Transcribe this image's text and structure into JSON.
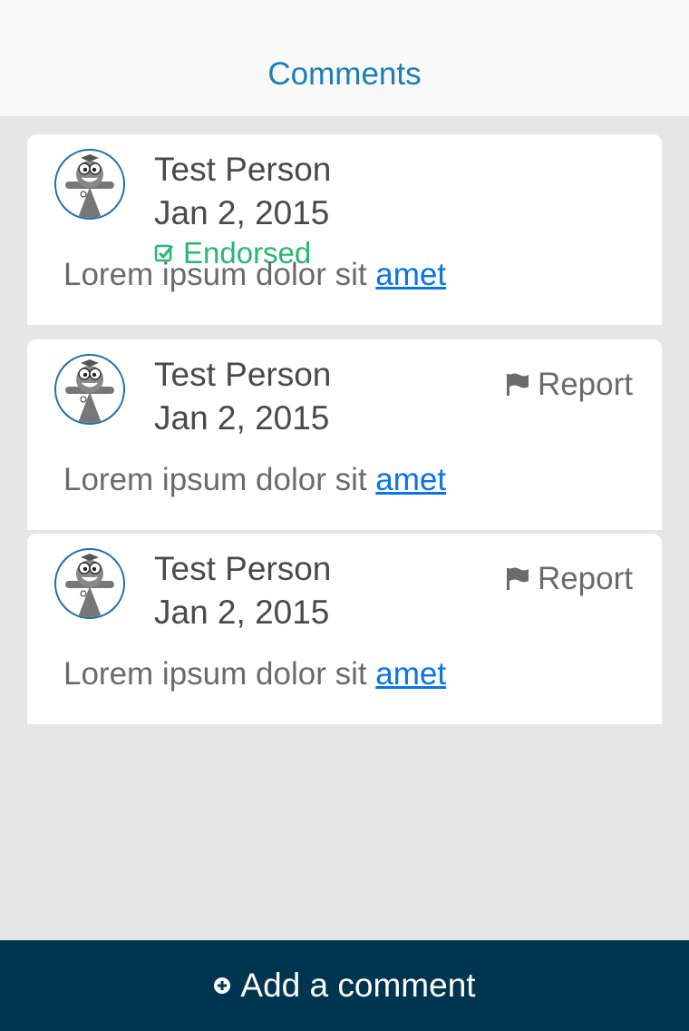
{
  "header": {
    "title": "Comments"
  },
  "comments": [
    {
      "author": "Test Person",
      "date": "Jan 2, 2015",
      "endorsed_label": "Endorsed",
      "body_text": "Lorem ipsum dolor sit ",
      "body_link": "amet"
    },
    {
      "author": "Test Person",
      "date": "Jan 2, 2015",
      "report_label": "Report",
      "body_text": "Lorem ipsum dolor sit ",
      "body_link": "amet"
    },
    {
      "author": "Test Person",
      "date": "Jan 2, 2015",
      "report_label": "Report",
      "body_text": "Lorem ipsum dolor sit ",
      "body_link": "amet"
    }
  ],
  "footer": {
    "add_comment_label": "Add a comment"
  },
  "colors": {
    "accent": "#1a7fb5",
    "endorsed": "#2bb673",
    "link": "#0a73e8",
    "footer_bg": "#00354f"
  },
  "icons": {
    "avatar": "mascot-avatar-icon",
    "endorsed": "checkbox-check-icon",
    "report": "flag-icon",
    "add": "plus-circle-icon"
  }
}
